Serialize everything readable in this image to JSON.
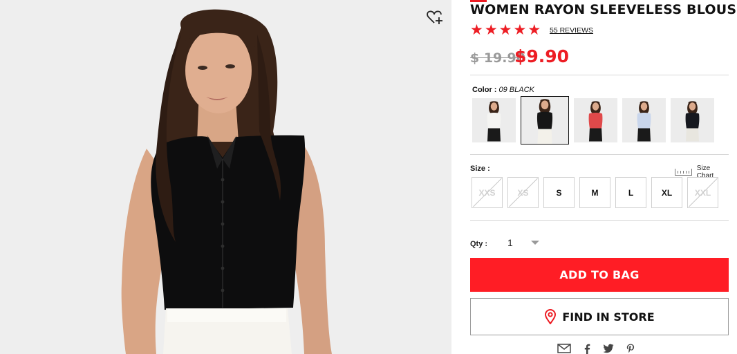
{
  "product": {
    "title": "WOMEN RAYON SLEEVELESS BLOUSE",
    "rating": 5,
    "reviews_label": "55 REVIEWS",
    "price_original": "$ 19.90",
    "price_sale": "$9.90"
  },
  "color": {
    "label": "Color :",
    "selected": "09 BLACK",
    "swatches": [
      {
        "top": "#f4f4f2",
        "bottom": "#1a1a1a"
      },
      {
        "top": "#161616",
        "bottom": "#f3f1ea"
      },
      {
        "top": "#e0494a",
        "bottom": "#1a1a1a"
      },
      {
        "top": "#c9d6ec",
        "bottom": "#1a1a1a"
      },
      {
        "top": "#16181f",
        "bottom": "#e8e6df"
      }
    ]
  },
  "size": {
    "label": "Size :",
    "chart_label": "Size Chart",
    "options": [
      "XXS",
      "XS",
      "S",
      "M",
      "L",
      "XL",
      "XXL"
    ],
    "available": [
      false,
      false,
      true,
      true,
      true,
      true,
      false
    ]
  },
  "qty": {
    "label": "Qty :",
    "value": "1"
  },
  "actions": {
    "add_to_bag": "ADD TO BAG",
    "find_in_store": "FIND IN STORE"
  },
  "share": [
    "mail-icon",
    "facebook-icon",
    "twitter-icon",
    "pinterest-icon"
  ],
  "colors": {
    "accent": "#ed1d24",
    "button": "#ff1d25"
  }
}
